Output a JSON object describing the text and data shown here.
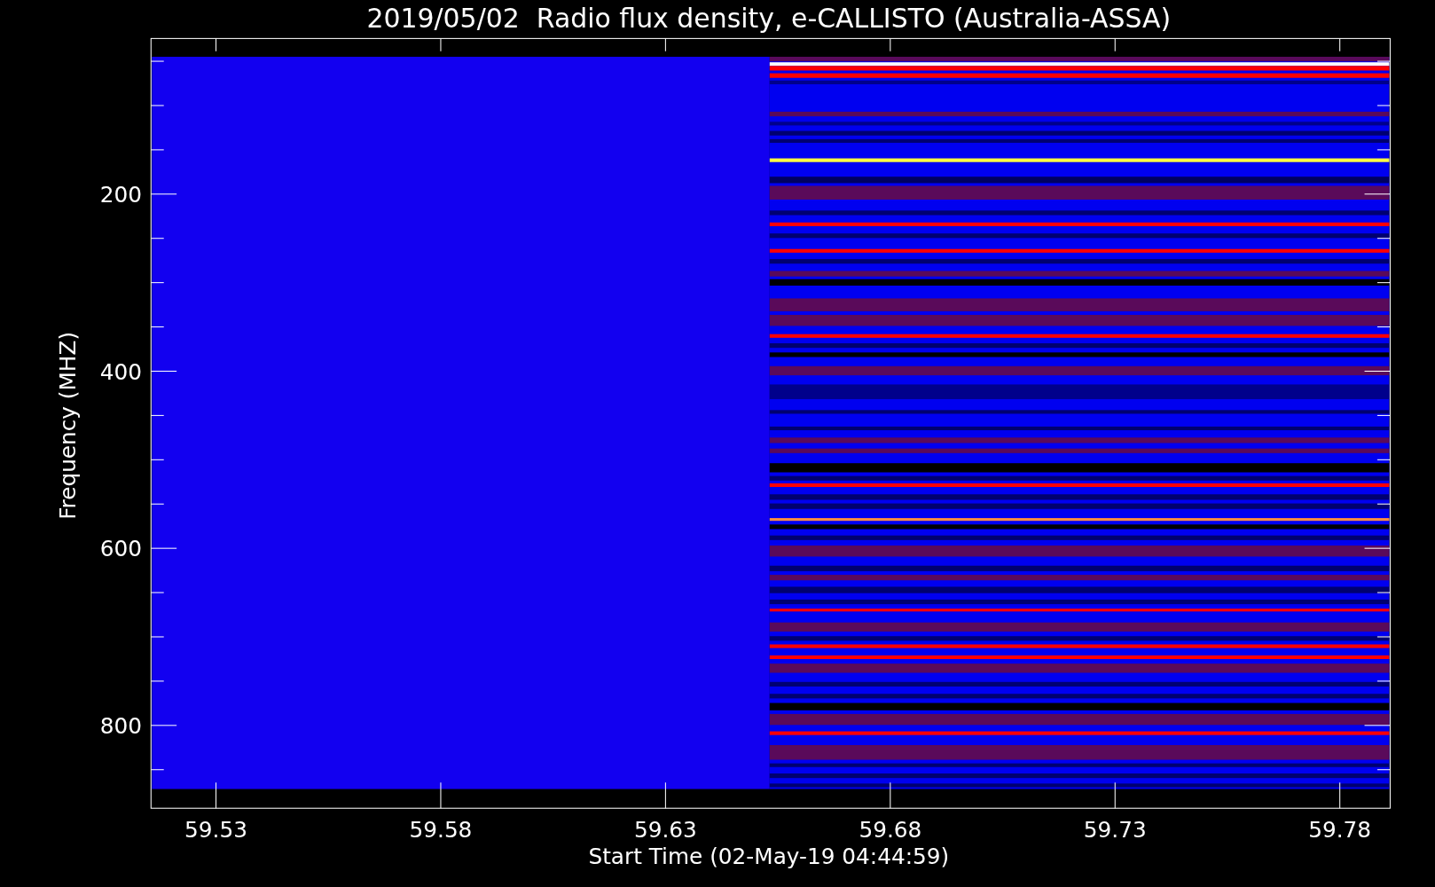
{
  "title": "2019/05/02  Radio flux density, e-CALLISTO (Australia-ASSA)",
  "y_axis": {
    "label": "Frequency (MHZ)",
    "ticks": [
      "200",
      "400",
      "600",
      "800"
    ]
  },
  "x_axis": {
    "label": "Start Time (02-May-19 04:44:59)",
    "ticks": [
      "59.53",
      "59.58",
      "59.63",
      "59.68",
      "59.73",
      "59.78"
    ]
  }
}
